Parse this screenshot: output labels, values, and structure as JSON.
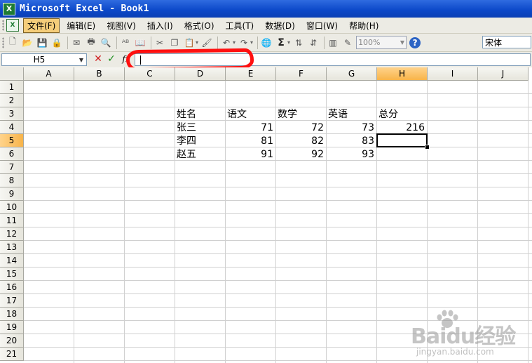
{
  "window": {
    "title": "Microsoft Excel - Book1",
    "app_icon_letter": "X"
  },
  "menu": {
    "doc_icon_letter": "X",
    "items": [
      "文件(F)",
      "编辑(E)",
      "视图(V)",
      "插入(I)",
      "格式(O)",
      "工具(T)",
      "数据(D)",
      "窗口(W)",
      "帮助(H)"
    ],
    "active_index": 0
  },
  "toolbar": {
    "icons": [
      "new-icon",
      "open-icon",
      "save-icon",
      "permission-icon",
      "email-icon",
      "print-icon",
      "print-preview-icon",
      "spelling-icon",
      "research-icon",
      "cut-icon",
      "copy-icon",
      "paste-icon",
      "format-painter-icon",
      "undo-icon",
      "redo-icon",
      "hyperlink-icon",
      "autosum-icon",
      "sort-ascending-icon",
      "sort-descending-icon",
      "chart-wizard-icon",
      "drawing-icon",
      "help-icon"
    ],
    "zoom": "100%",
    "font_name": "宋体",
    "autosum_symbol": "Σ"
  },
  "formula_bar": {
    "name_box": "H5",
    "fx_label": "fx",
    "cancel_symbol": "✕",
    "enter_symbol": "✓",
    "formula": ""
  },
  "sheet": {
    "columns": [
      "A",
      "B",
      "C",
      "D",
      "E",
      "F",
      "G",
      "H",
      "I",
      "J"
    ],
    "rows": [
      "1",
      "2",
      "3",
      "4",
      "5",
      "6",
      "7",
      "8",
      "9",
      "10",
      "11",
      "12",
      "13",
      "14",
      "15",
      "16",
      "17",
      "18",
      "19",
      "20",
      "21"
    ],
    "selected_column": "H",
    "selected_row": "5",
    "cells": {
      "D3": "姓名",
      "E3": "语文",
      "F3": "数学",
      "G3": "英语",
      "H3": "总分",
      "D4": "张三",
      "E4": "71",
      "F4": "72",
      "G4": "73",
      "H4": "216",
      "D5": "李四",
      "E5": "81",
      "F5": "82",
      "G5": "83",
      "D6": "赵五",
      "E6": "91",
      "F6": "92",
      "G6": "93"
    },
    "numeric_cells": [
      "E4",
      "F4",
      "G4",
      "H4",
      "E5",
      "F5",
      "G5",
      "E6",
      "F6",
      "G6"
    ]
  },
  "annotation": {
    "highlight_color": "#ff1010"
  },
  "watermark": {
    "brand": "Baidu经验",
    "url": "jingyan.baidu.com"
  }
}
